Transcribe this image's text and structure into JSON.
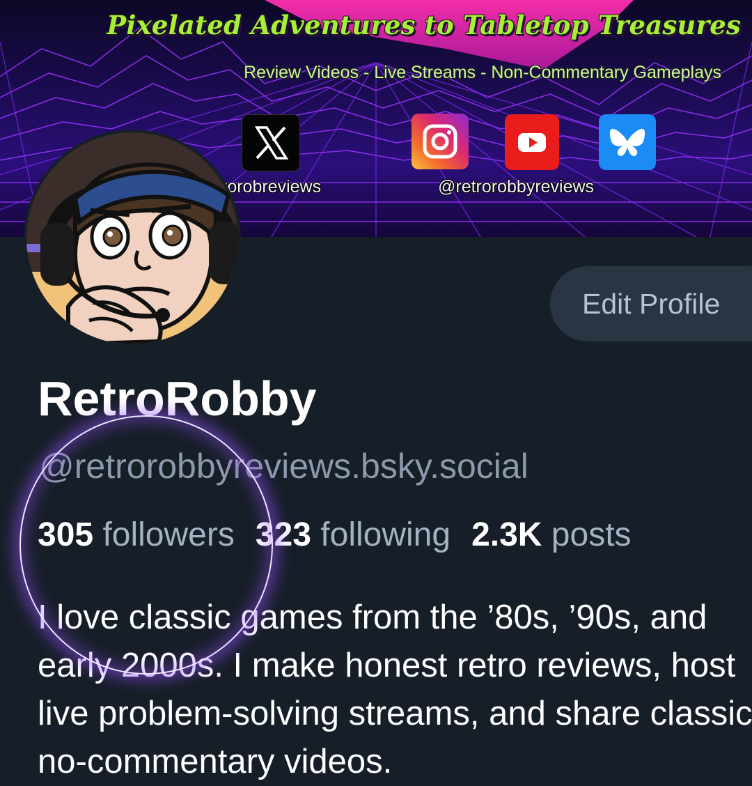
{
  "banner": {
    "title": "Pixelated Adventures to Tabletop Treasures",
    "subtitle": "Review Videos - Live Streams - Non-Commentary Gameplays",
    "handle_left": "rorobreviews",
    "handle_right": "@retrorobbyreviews",
    "icons": [
      "x-icon",
      "instagram-icon",
      "youtube-icon",
      "bluesky-icon"
    ]
  },
  "profile": {
    "edit_label": "Edit Profile",
    "display_name": "RetroRobby",
    "handle": "@retrorobbyreviews.bsky.social",
    "stats": {
      "followers_count": "305",
      "followers_label": "followers",
      "following_count": "323",
      "following_label": "following",
      "posts_count": "2.3K",
      "posts_label": "posts"
    },
    "bio": [
      "I love classic games from the ’80s, ’90s, and",
      "early 2000s. I make honest retro reviews, host",
      "live problem-solving streams, and share classic",
      "no-commentary videos."
    ]
  },
  "colors": {
    "background": "#161e27",
    "button_bg": "#2a3543",
    "muted_text": "#8d9aac",
    "highlight_glow": "#9650ff",
    "banner_title": "#a9ef3a"
  }
}
